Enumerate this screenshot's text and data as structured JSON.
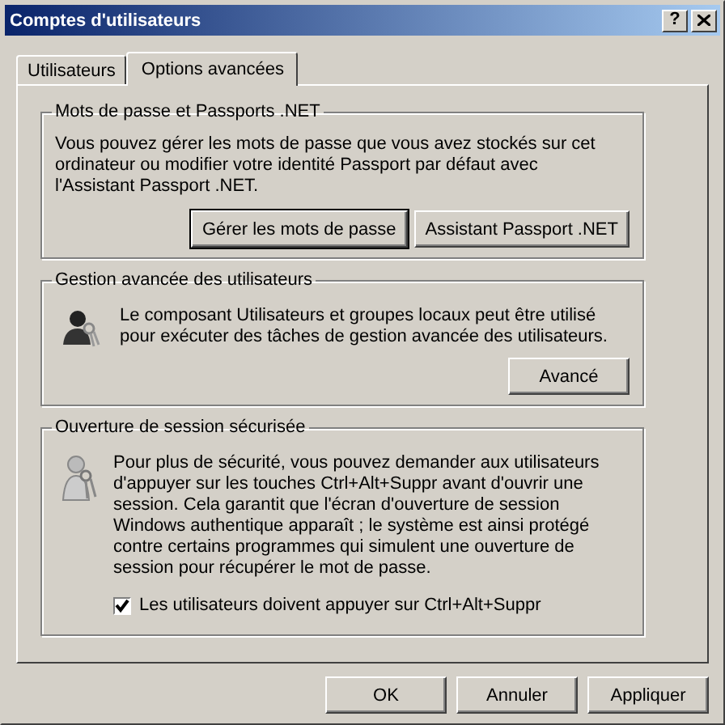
{
  "window": {
    "title": "Comptes d'utilisateurs",
    "help": "?"
  },
  "tabs": [
    {
      "label": "Utilisateurs",
      "selected": false
    },
    {
      "label": "Options avancées",
      "selected": true
    }
  ],
  "passwords": {
    "title": "Mots de passe et Passports .NET",
    "text": "Vous pouvez gérer les mots de passe que vous avez stockés sur cet\nordinateur ou modifier votre identité Passport par défaut avec\nl'Assistant Passport .NET.",
    "buttons": [
      {
        "label": "Gérer les mots de passe",
        "default": true
      },
      {
        "label": "Assistant Passport .NET",
        "default": false
      }
    ]
  },
  "advanced": {
    "title": "Gestion avancée des utilisateurs",
    "text": "Le composant Utilisateurs et groupes locaux peut être utilisé\npour exécuter des tâches de gestion avancée des utilisateurs.",
    "button": "Avancé"
  },
  "secure_logon": {
    "title": "Ouverture de session sécurisée",
    "text": "Pour plus de sécurité, vous pouvez demander aux utilisateurs\nd'appuyer sur les touches Ctrl+Alt+Suppr avant d'ouvrir une\nsession. Cela garantit que l'écran d'ouverture de session\nWindows authentique apparaît ; le système est ainsi protégé\ncontre certains programmes qui simulent une ouverture de\nsession pour récupérer le mot de passe.",
    "checkbox": {
      "label": "Les utilisateurs doivent appuyer sur Ctrl+Alt+Suppr",
      "checked": true
    }
  },
  "buttons": [
    "OK",
    "Annuler",
    "Appliquer"
  ]
}
